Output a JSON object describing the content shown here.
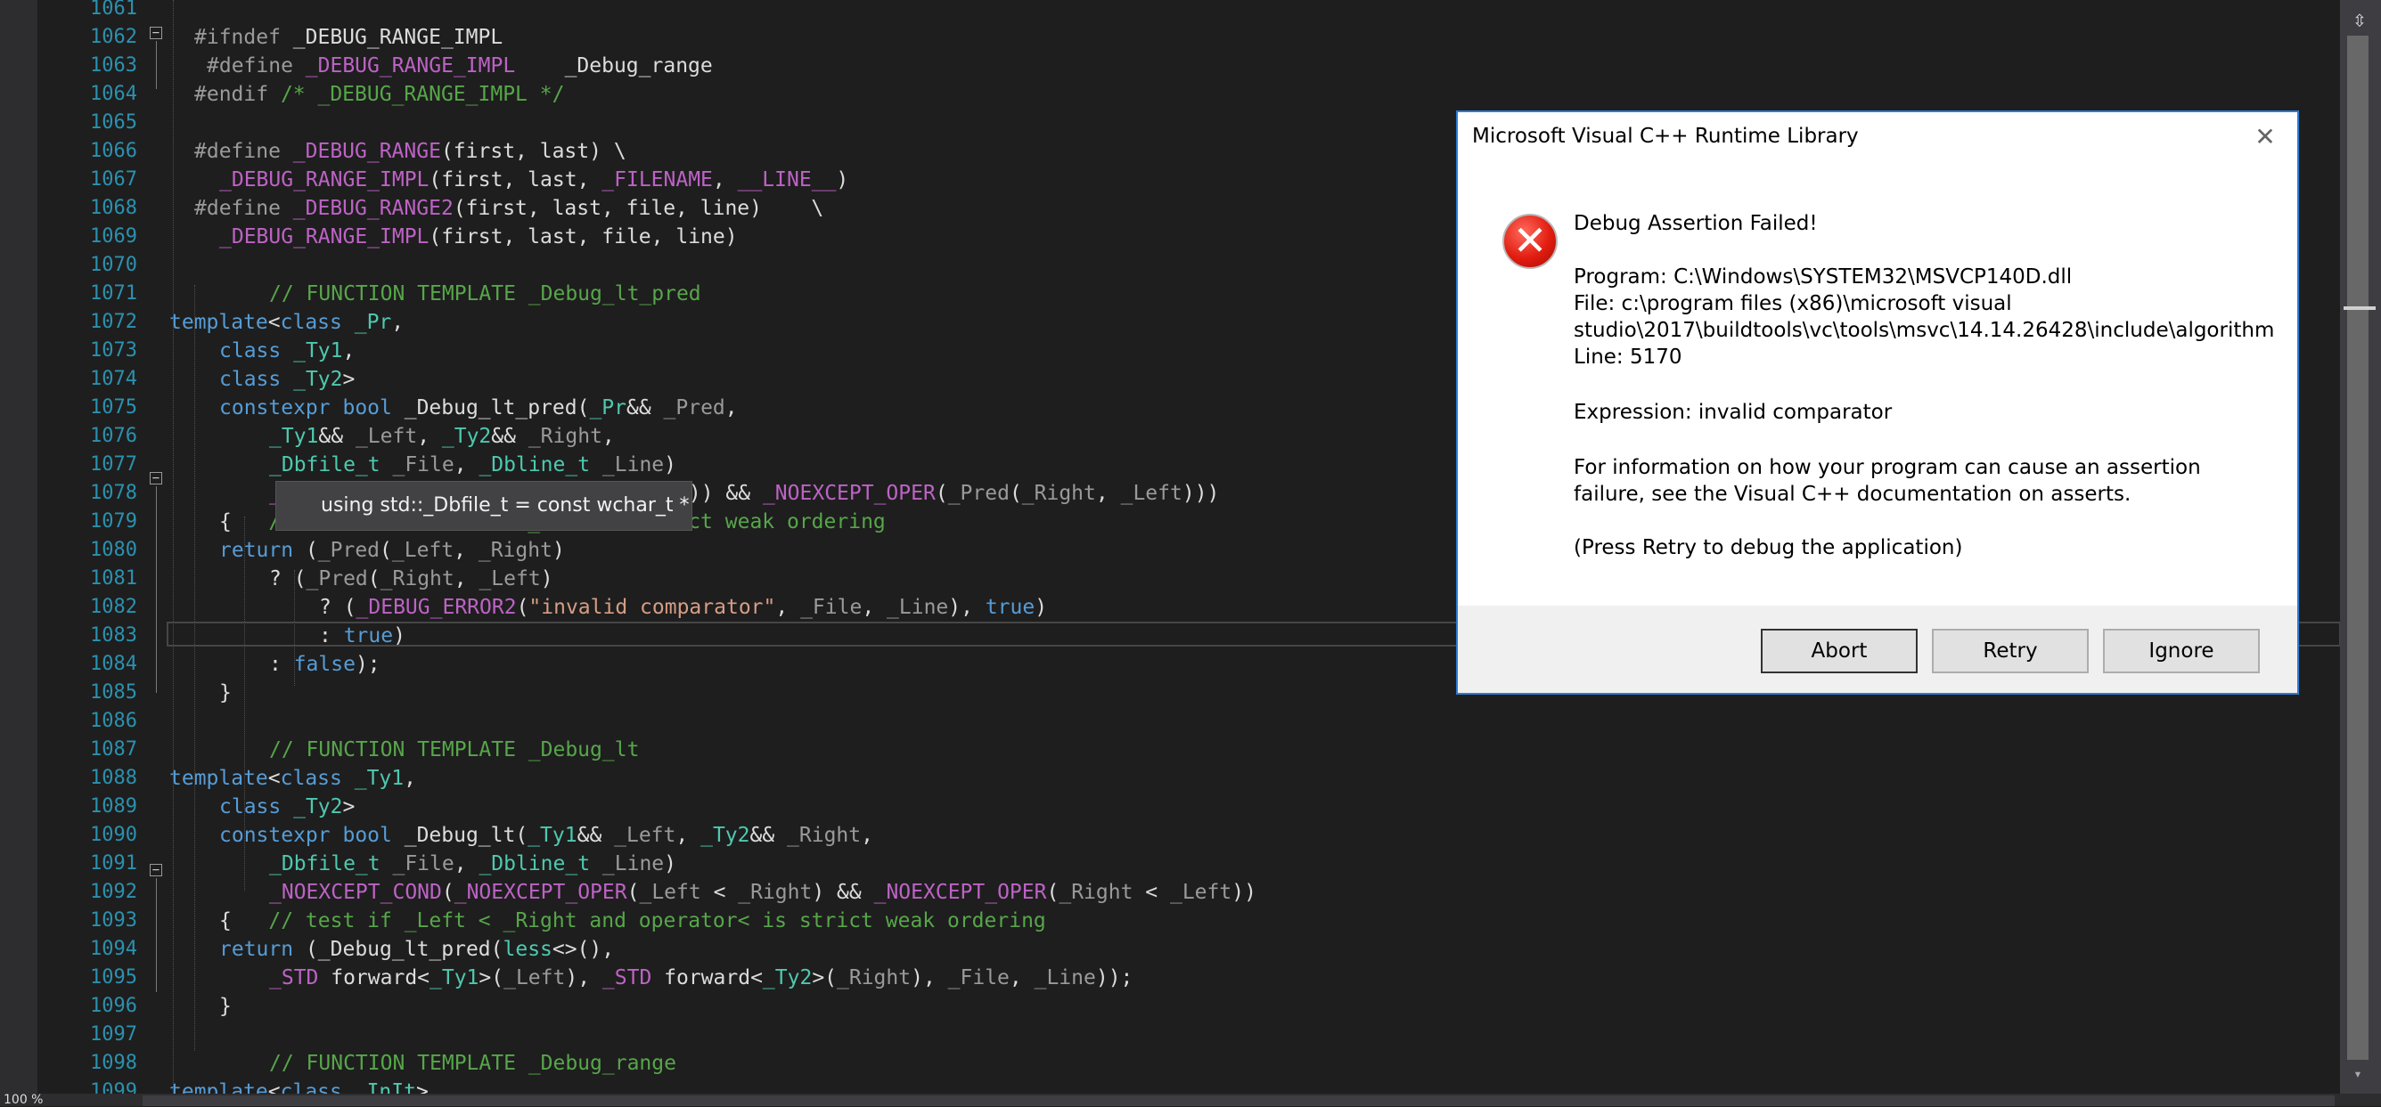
{
  "editor": {
    "zoom": "100 %",
    "lines": [
      {
        "n": "1061",
        "segs": [
          {
            "t": "",
            "c": "#dcdcdc"
          }
        ],
        "indent": 0
      },
      {
        "n": "1062",
        "segs": [
          {
            "t": "#ifndef",
            "c": "#9b9b9b"
          },
          {
            "t": " _DEBUG_RANGE_IMPL",
            "c": "#dcdcdc"
          }
        ],
        "indent": 28
      },
      {
        "n": "1063",
        "segs": [
          {
            "t": "#define",
            "c": "#9b9b9b"
          },
          {
            "t": " _DEBUG_RANGE_IMPL",
            "c": "#bd63c5"
          },
          {
            "t": "    _Debug_range",
            "c": "#dcdcdc"
          }
        ],
        "indent": 42
      },
      {
        "n": "1064",
        "segs": [
          {
            "t": "#endif",
            "c": "#9b9b9b"
          },
          {
            "t": " /* _DEBUG_RANGE_IMPL */",
            "c": "#57a64a"
          }
        ],
        "indent": 28
      },
      {
        "n": "1065",
        "segs": [
          {
            "t": "",
            "c": "#dcdcdc"
          }
        ],
        "indent": 0
      },
      {
        "n": "1066",
        "segs": [
          {
            "t": "#define",
            "c": "#9b9b9b"
          },
          {
            "t": " _DEBUG_RANGE",
            "c": "#bd63c5"
          },
          {
            "t": "(first, last) \\",
            "c": "#dcdcdc"
          }
        ],
        "indent": 28
      },
      {
        "n": "1067",
        "segs": [
          {
            "t": "_DEBUG_RANGE_IMPL",
            "c": "#bd63c5"
          },
          {
            "t": "(first, last, ",
            "c": "#dcdcdc"
          },
          {
            "t": "_FILENAME",
            "c": "#bd63c5"
          },
          {
            "t": ", ",
            "c": "#dcdcdc"
          },
          {
            "t": "__LINE__",
            "c": "#bd63c5"
          },
          {
            "t": ")",
            "c": "#dcdcdc"
          }
        ],
        "indent": 56
      },
      {
        "n": "1068",
        "segs": [
          {
            "t": "#define",
            "c": "#9b9b9b"
          },
          {
            "t": " _DEBUG_RANGE2",
            "c": "#bd63c5"
          },
          {
            "t": "(first, last, file, line)    \\",
            "c": "#dcdcdc"
          }
        ],
        "indent": 28
      },
      {
        "n": "1069",
        "segs": [
          {
            "t": "_DEBUG_RANGE_IMPL",
            "c": "#bd63c5"
          },
          {
            "t": "(first, last, file, line)",
            "c": "#dcdcdc"
          }
        ],
        "indent": 56
      },
      {
        "n": "1070",
        "segs": [
          {
            "t": "",
            "c": "#dcdcdc"
          }
        ],
        "indent": 0
      },
      {
        "n": "1071",
        "segs": [
          {
            "t": "// FUNCTION TEMPLATE _Debug_lt_pred",
            "c": "#57a64a"
          }
        ],
        "indent": 112
      },
      {
        "n": "1072",
        "segs": [
          {
            "t": "template",
            "c": "#569cd6"
          },
          {
            "t": "<",
            "c": "#dcdcdc"
          },
          {
            "t": "class",
            "c": "#569cd6"
          },
          {
            "t": " _Pr",
            "c": "#4ec9b0"
          },
          {
            "t": ",",
            "c": "#dcdcdc"
          }
        ],
        "indent": 0
      },
      {
        "n": "1073",
        "segs": [
          {
            "t": "class",
            "c": "#569cd6"
          },
          {
            "t": " _Ty1",
            "c": "#4ec9b0"
          },
          {
            "t": ",",
            "c": "#dcdcdc"
          }
        ],
        "indent": 56
      },
      {
        "n": "1074",
        "segs": [
          {
            "t": "class",
            "c": "#569cd6"
          },
          {
            "t": " _Ty2",
            "c": "#4ec9b0"
          },
          {
            "t": ">",
            "c": "#dcdcdc"
          }
        ],
        "indent": 56
      },
      {
        "n": "1075",
        "segs": [
          {
            "t": "constexpr",
            "c": "#569cd6"
          },
          {
            "t": " ",
            "c": "#dcdcdc"
          },
          {
            "t": "bool",
            "c": "#569cd6"
          },
          {
            "t": " _Debug_lt_pred(",
            "c": "#dcdcdc"
          },
          {
            "t": "_Pr",
            "c": "#4ec9b0"
          },
          {
            "t": "&& ",
            "c": "#dcdcdc"
          },
          {
            "t": "_Pred",
            "c": "#9a9a9a"
          },
          {
            "t": ",",
            "c": "#dcdcdc"
          }
        ],
        "indent": 56
      },
      {
        "n": "1076",
        "segs": [
          {
            "t": "_Ty1",
            "c": "#4ec9b0"
          },
          {
            "t": "&& ",
            "c": "#dcdcdc"
          },
          {
            "t": "_Left",
            "c": "#9a9a9a"
          },
          {
            "t": ", ",
            "c": "#dcdcdc"
          },
          {
            "t": "_Ty2",
            "c": "#4ec9b0"
          },
          {
            "t": "&& ",
            "c": "#dcdcdc"
          },
          {
            "t": "_Right",
            "c": "#9a9a9a"
          },
          {
            "t": ",",
            "c": "#dcdcdc"
          }
        ],
        "indent": 112
      },
      {
        "n": "1077",
        "segs": [
          {
            "t": "_Dbfile_t",
            "c": "#4ec9b0"
          },
          {
            "t": " ",
            "c": "#dcdcdc"
          },
          {
            "t": "_File",
            "c": "#9a9a9a"
          },
          {
            "t": ", ",
            "c": "#dcdcdc"
          },
          {
            "t": "_Dbline_t",
            "c": "#4ec9b0"
          },
          {
            "t": " ",
            "c": "#dcdcdc"
          },
          {
            "t": "_Line",
            "c": "#9a9a9a"
          },
          {
            "t": ")",
            "c": "#dcdcdc"
          }
        ],
        "indent": 112
      },
      {
        "n": "1078",
        "segs": [
          {
            "t": "_N",
            "c": "#bd63c5"
          },
          {
            "t": "                 ",
            "c": "#dcdcdc"
          },
          {
            "t": "d(",
            "c": "#dcdcdc"
          },
          {
            "t": "_Left",
            "c": "#9a9a9a"
          },
          {
            "t": ", ",
            "c": "#dcdcdc"
          },
          {
            "t": "_Right",
            "c": "#9a9a9a"
          },
          {
            "t": ")) && ",
            "c": "#dcdcdc"
          },
          {
            "t": "_NOEXCEPT_OPER",
            "c": "#bd63c5"
          },
          {
            "t": "(",
            "c": "#dcdcdc"
          },
          {
            "t": "_Pred",
            "c": "#9a9a9a"
          },
          {
            "t": "(",
            "c": "#dcdcdc"
          },
          {
            "t": "_Right",
            "c": "#9a9a9a"
          },
          {
            "t": ", ",
            "c": "#dcdcdc"
          },
          {
            "t": "_Left",
            "c": "#9a9a9a"
          },
          {
            "t": ")))",
            "c": "#dcdcdc"
          }
        ],
        "indent": 112
      },
      {
        "n": "1079",
        "segs": [
          {
            "t": "{   ",
            "c": "#dcdcdc"
          },
          {
            "t": "//",
            "c": "#57a64a"
          },
          {
            "t": "                 ",
            "c": "#dcdcdc"
          },
          {
            "t": "d _Pred is strict weak ordering",
            "c": "#57a64a"
          }
        ],
        "indent": 56
      },
      {
        "n": "1080",
        "segs": [
          {
            "t": "return",
            "c": "#569cd6"
          },
          {
            "t": " (",
            "c": "#dcdcdc"
          },
          {
            "t": "_Pred",
            "c": "#9a9a9a"
          },
          {
            "t": "(",
            "c": "#dcdcdc"
          },
          {
            "t": "_Left",
            "c": "#9a9a9a"
          },
          {
            "t": ", ",
            "c": "#dcdcdc"
          },
          {
            "t": "_Right",
            "c": "#9a9a9a"
          },
          {
            "t": ")",
            "c": "#dcdcdc"
          }
        ],
        "indent": 56
      },
      {
        "n": "1081",
        "segs": [
          {
            "t": "? (",
            "c": "#dcdcdc"
          },
          {
            "t": "_Pred",
            "c": "#9a9a9a"
          },
          {
            "t": "(",
            "c": "#dcdcdc"
          },
          {
            "t": "_Right",
            "c": "#9a9a9a"
          },
          {
            "t": ", ",
            "c": "#dcdcdc"
          },
          {
            "t": "_Left",
            "c": "#9a9a9a"
          },
          {
            "t": ")",
            "c": "#dcdcdc"
          }
        ],
        "indent": 112
      },
      {
        "n": "1082",
        "segs": [
          {
            "t": "? (",
            "c": "#dcdcdc"
          },
          {
            "t": "_DEBUG_ERROR2",
            "c": "#bd63c5"
          },
          {
            "t": "(",
            "c": "#dcdcdc"
          },
          {
            "t": "\"invalid comparator\"",
            "c": "#d69d85"
          },
          {
            "t": ", ",
            "c": "#dcdcdc"
          },
          {
            "t": "_File",
            "c": "#9a9a9a"
          },
          {
            "t": ", ",
            "c": "#dcdcdc"
          },
          {
            "t": "_Line",
            "c": "#9a9a9a"
          },
          {
            "t": "), ",
            "c": "#dcdcdc"
          },
          {
            "t": "true",
            "c": "#569cd6"
          },
          {
            "t": ")",
            "c": "#dcdcdc"
          }
        ],
        "indent": 168
      },
      {
        "n": "1083",
        "segs": [
          {
            "t": ": ",
            "c": "#dcdcdc"
          },
          {
            "t": "true",
            "c": "#569cd6"
          },
          {
            "t": ")",
            "c": "#dcdcdc"
          }
        ],
        "indent": 168
      },
      {
        "n": "1084",
        "segs": [
          {
            "t": ": ",
            "c": "#dcdcdc"
          },
          {
            "t": "false",
            "c": "#569cd6"
          },
          {
            "t": ");",
            "c": "#dcdcdc"
          }
        ],
        "indent": 112
      },
      {
        "n": "1085",
        "segs": [
          {
            "t": "}",
            "c": "#dcdcdc"
          }
        ],
        "indent": 56
      },
      {
        "n": "1086",
        "segs": [
          {
            "t": "",
            "c": "#dcdcdc"
          }
        ],
        "indent": 0
      },
      {
        "n": "1087",
        "segs": [
          {
            "t": "// FUNCTION TEMPLATE _Debug_lt",
            "c": "#57a64a"
          }
        ],
        "indent": 112
      },
      {
        "n": "1088",
        "segs": [
          {
            "t": "template",
            "c": "#569cd6"
          },
          {
            "t": "<",
            "c": "#dcdcdc"
          },
          {
            "t": "class",
            "c": "#569cd6"
          },
          {
            "t": " _Ty1",
            "c": "#4ec9b0"
          },
          {
            "t": ",",
            "c": "#dcdcdc"
          }
        ],
        "indent": 0
      },
      {
        "n": "1089",
        "segs": [
          {
            "t": "class",
            "c": "#569cd6"
          },
          {
            "t": " _Ty2",
            "c": "#4ec9b0"
          },
          {
            "t": ">",
            "c": "#dcdcdc"
          }
        ],
        "indent": 56
      },
      {
        "n": "1090",
        "segs": [
          {
            "t": "constexpr",
            "c": "#569cd6"
          },
          {
            "t": " ",
            "c": "#dcdcdc"
          },
          {
            "t": "bool",
            "c": "#569cd6"
          },
          {
            "t": " _Debug_lt(",
            "c": "#dcdcdc"
          },
          {
            "t": "_Ty1",
            "c": "#4ec9b0"
          },
          {
            "t": "&& ",
            "c": "#dcdcdc"
          },
          {
            "t": "_Left",
            "c": "#9a9a9a"
          },
          {
            "t": ", ",
            "c": "#dcdcdc"
          },
          {
            "t": "_Ty2",
            "c": "#4ec9b0"
          },
          {
            "t": "&& ",
            "c": "#dcdcdc"
          },
          {
            "t": "_Right",
            "c": "#9a9a9a"
          },
          {
            "t": ",",
            "c": "#dcdcdc"
          }
        ],
        "indent": 56
      },
      {
        "n": "1091",
        "segs": [
          {
            "t": "_Dbfile_t",
            "c": "#4ec9b0"
          },
          {
            "t": " ",
            "c": "#dcdcdc"
          },
          {
            "t": "_File",
            "c": "#9a9a9a"
          },
          {
            "t": ", ",
            "c": "#dcdcdc"
          },
          {
            "t": "_Dbline_t",
            "c": "#4ec9b0"
          },
          {
            "t": " ",
            "c": "#dcdcdc"
          },
          {
            "t": "_Line",
            "c": "#9a9a9a"
          },
          {
            "t": ")",
            "c": "#dcdcdc"
          }
        ],
        "indent": 112
      },
      {
        "n": "1092",
        "segs": [
          {
            "t": "_NOEXCEPT_COND",
            "c": "#bd63c5"
          },
          {
            "t": "(",
            "c": "#dcdcdc"
          },
          {
            "t": "_NOEXCEPT_OPER",
            "c": "#bd63c5"
          },
          {
            "t": "(",
            "c": "#dcdcdc"
          },
          {
            "t": "_Left",
            "c": "#9a9a9a"
          },
          {
            "t": " < ",
            "c": "#dcdcdc"
          },
          {
            "t": "_Right",
            "c": "#9a9a9a"
          },
          {
            "t": ") && ",
            "c": "#dcdcdc"
          },
          {
            "t": "_NOEXCEPT_OPER",
            "c": "#bd63c5"
          },
          {
            "t": "(",
            "c": "#dcdcdc"
          },
          {
            "t": "_Right",
            "c": "#9a9a9a"
          },
          {
            "t": " < ",
            "c": "#dcdcdc"
          },
          {
            "t": "_Left",
            "c": "#9a9a9a"
          },
          {
            "t": "))",
            "c": "#dcdcdc"
          }
        ],
        "indent": 112
      },
      {
        "n": "1093",
        "segs": [
          {
            "t": "{   ",
            "c": "#dcdcdc"
          },
          {
            "t": "// test if _Left < _Right and operator< is strict weak ordering",
            "c": "#57a64a"
          }
        ],
        "indent": 56
      },
      {
        "n": "1094",
        "segs": [
          {
            "t": "return",
            "c": "#569cd6"
          },
          {
            "t": " (_Debug_lt_pred(",
            "c": "#dcdcdc"
          },
          {
            "t": "less",
            "c": "#4ec9b0"
          },
          {
            "t": "<>(),",
            "c": "#dcdcdc"
          }
        ],
        "indent": 56
      },
      {
        "n": "1095",
        "segs": [
          {
            "t": "_STD",
            "c": "#bd63c5"
          },
          {
            "t": " forward<",
            "c": "#dcdcdc"
          },
          {
            "t": "_Ty1",
            "c": "#4ec9b0"
          },
          {
            "t": ">(",
            "c": "#dcdcdc"
          },
          {
            "t": "_Left",
            "c": "#9a9a9a"
          },
          {
            "t": "), ",
            "c": "#dcdcdc"
          },
          {
            "t": "_STD",
            "c": "#bd63c5"
          },
          {
            "t": " forward<",
            "c": "#dcdcdc"
          },
          {
            "t": "_Ty2",
            "c": "#4ec9b0"
          },
          {
            "t": ">(",
            "c": "#dcdcdc"
          },
          {
            "t": "_Right",
            "c": "#9a9a9a"
          },
          {
            "t": "), ",
            "c": "#dcdcdc"
          },
          {
            "t": "_File",
            "c": "#9a9a9a"
          },
          {
            "t": ", ",
            "c": "#dcdcdc"
          },
          {
            "t": "_Line",
            "c": "#9a9a9a"
          },
          {
            "t": "));",
            "c": "#dcdcdc"
          }
        ],
        "indent": 112
      },
      {
        "n": "1096",
        "segs": [
          {
            "t": "}",
            "c": "#dcdcdc"
          }
        ],
        "indent": 56
      },
      {
        "n": "1097",
        "segs": [
          {
            "t": "",
            "c": "#dcdcdc"
          }
        ],
        "indent": 0
      },
      {
        "n": "1098",
        "segs": [
          {
            "t": "// FUNCTION TEMPLATE _Debug_range",
            "c": "#57a64a"
          }
        ],
        "indent": 112
      },
      {
        "n": "1099",
        "segs": [
          {
            "t": "template",
            "c": "#569cd6"
          },
          {
            "t": "<",
            "c": "#dcdcdc"
          },
          {
            "t": "class",
            "c": "#569cd6"
          },
          {
            "t": " _InIt",
            "c": "#4ec9b0"
          },
          {
            "t": ">",
            "c": "#dcdcdc"
          }
        ],
        "indent": 0
      }
    ]
  },
  "tooltip": {
    "text": "using std::_Dbfile_t = const wchar_t *"
  },
  "dialog": {
    "title": "Microsoft Visual C++ Runtime Library",
    "close_glyph": "✕",
    "heading": "Debug Assertion Failed!",
    "program": "Program: C:\\Windows\\SYSTEM32\\MSVCP140D.dll",
    "file_line1": "File: c:\\program files (x86)\\microsoft visual",
    "file_line2": "studio\\2017\\buildtools\\vc\\tools\\msvc\\14.14.26428\\include\\algorithm",
    "line": "Line: 5170",
    "expression": "Expression: invalid comparator",
    "info_line1": "For information on how your program can cause an assertion",
    "info_line2": "failure, see the Visual C++ documentation on asserts.",
    "press_retry": "(Press Retry to debug the application)",
    "buttons": {
      "abort": "Abort",
      "retry": "Retry",
      "ignore": "Ignore"
    },
    "error_glyph": "✕"
  },
  "icons": {
    "split": "⇳",
    "fold": "⊟",
    "scroll_down": "▾"
  },
  "colors": {
    "background": "#1e1e1e",
    "line_number": "#2b91af",
    "keyword": "#569cd6",
    "type": "#4ec9b0",
    "macro": "#bd63c5",
    "comment": "#57a64a",
    "string": "#d69d85",
    "param": "#9a9a9a",
    "dialog_accent": "#2b7cd3",
    "error_red": "#e11d10"
  }
}
